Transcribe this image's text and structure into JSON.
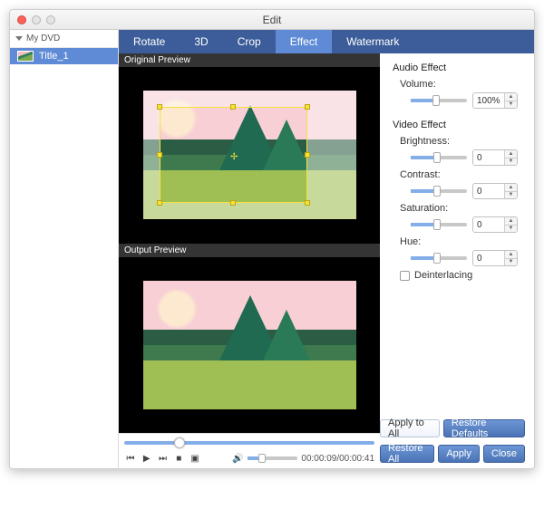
{
  "window": {
    "title": "Edit"
  },
  "sidebar": {
    "root_label": "My DVD",
    "items": [
      {
        "label": "Title_1"
      }
    ]
  },
  "tabs": [
    {
      "label": "Rotate",
      "active": false
    },
    {
      "label": "3D",
      "active": false
    },
    {
      "label": "Crop",
      "active": false
    },
    {
      "label": "Effect",
      "active": true
    },
    {
      "label": "Watermark",
      "active": false
    }
  ],
  "previews": {
    "original_label": "Original Preview",
    "output_label": "Output Preview"
  },
  "player": {
    "time_display": "00:00:09/00:00:41",
    "position_pct": 20,
    "volume_pct": 22
  },
  "audio_effect": {
    "section_label": "Audio Effect",
    "volume": {
      "label": "Volume:",
      "value": "100%",
      "pct": 38
    }
  },
  "video_effect": {
    "section_label": "Video Effect",
    "brightness": {
      "label": "Brightness:",
      "value": "0",
      "pct": 40
    },
    "contrast": {
      "label": "Contrast:",
      "value": "0",
      "pct": 40
    },
    "saturation": {
      "label": "Saturation:",
      "value": "0",
      "pct": 40
    },
    "hue": {
      "label": "Hue:",
      "value": "0",
      "pct": 40
    },
    "deinterlacing": {
      "label": "Deinterlacing",
      "checked": false
    }
  },
  "buttons": {
    "apply_to_all": "Apply to All",
    "restore_defaults": "Restore Defaults",
    "restore_all": "Restore All",
    "apply": "Apply",
    "close": "Close"
  }
}
